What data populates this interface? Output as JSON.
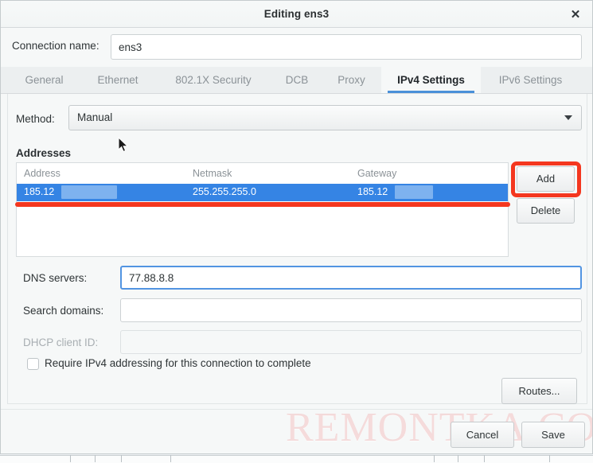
{
  "window": {
    "title": "Editing ens3",
    "close_icon": "close-icon"
  },
  "connection": {
    "label": "Connection name:",
    "value": "ens3",
    "placeholder": ""
  },
  "tabs": [
    {
      "label": "General",
      "active": false
    },
    {
      "label": "Ethernet",
      "active": false
    },
    {
      "label": "802.1X Security",
      "active": false
    },
    {
      "label": "DCB",
      "active": false
    },
    {
      "label": "Proxy",
      "active": false
    },
    {
      "label": "IPv4 Settings",
      "active": true
    },
    {
      "label": "IPv6 Settings",
      "active": false
    }
  ],
  "method": {
    "label": "Method:",
    "value": "Manual",
    "arrow_icon": "chevron-down-icon",
    "options": [
      "Manual"
    ]
  },
  "addresses": {
    "section_title": "Addresses",
    "columns": [
      "Address",
      "Netmask",
      "Gateway"
    ],
    "rows": [
      {
        "address": "185.12",
        "address_redacted": true,
        "netmask": "255.255.255.0",
        "gateway": "185.12",
        "gateway_redacted": true,
        "selected": true
      }
    ],
    "add_label": "Add",
    "delete_label": "Delete"
  },
  "fields": {
    "dns": {
      "label": "DNS servers:",
      "value": "77.88.8.8",
      "placeholder": "",
      "focused": true,
      "disabled": false
    },
    "search_domains": {
      "label": "Search domains:",
      "value": "",
      "placeholder": "",
      "focused": false,
      "disabled": false
    },
    "dhcp_client_id": {
      "label": "DHCP client ID:",
      "value": "",
      "placeholder": "",
      "focused": false,
      "disabled": true
    }
  },
  "require_ipv4": {
    "label": "Require IPv4 addressing for this connection to complete",
    "checked": false
  },
  "routes": {
    "label": "Routes..."
  },
  "actions": {
    "cancel_label": "Cancel",
    "save_label": "Save"
  },
  "watermark": {
    "text": "REMONTKA.COM"
  },
  "annotations": {
    "highlight_color": "#f4371f",
    "add_button_box": true,
    "selected_row_underline": true
  },
  "colors": {
    "accent": "#3584e4",
    "tab_underline": "#4a90d9",
    "selection": "#3584e4",
    "annotation": "#f4371f",
    "redaction": "#7eb2ef"
  }
}
